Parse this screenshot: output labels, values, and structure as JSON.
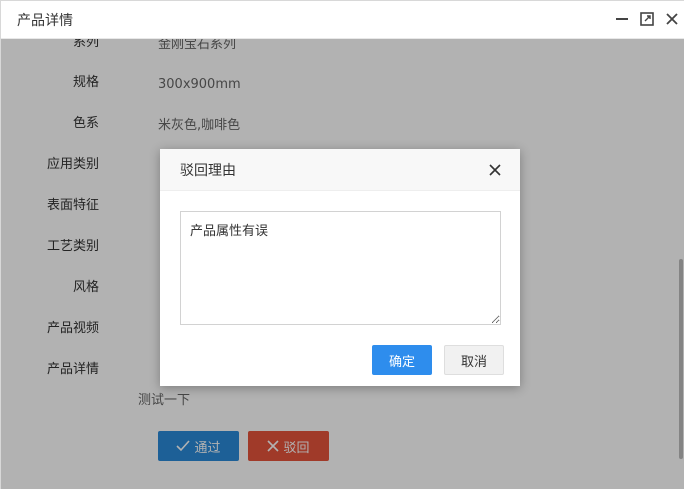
{
  "window": {
    "title": "产品详情",
    "controls": [
      {
        "icon": "minimize-icon"
      },
      {
        "icon": "maximize-icon"
      },
      {
        "icon": "close-icon"
      }
    ]
  },
  "details": {
    "rows": [
      {
        "label": "系列",
        "value": "金刚宝石系列"
      },
      {
        "label": "规格",
        "value": "300x900mm"
      },
      {
        "label": "色系",
        "value": "米灰色,咖啡色"
      },
      {
        "label": "应用类别",
        "value": ""
      },
      {
        "label": "表面特征",
        "value": ""
      },
      {
        "label": "工艺类别",
        "value": ""
      },
      {
        "label": "风格",
        "value": ""
      },
      {
        "label": "产品视频",
        "value": ""
      },
      {
        "label": "产品详情",
        "value": ""
      }
    ],
    "detail_text": "测试一下"
  },
  "actions": {
    "pass_label": "通过",
    "pass_icon": "check-icon",
    "reject_label": "驳回",
    "reject_icon": "x-icon"
  },
  "dialog": {
    "title": "驳回理由",
    "reason_value": "产品属性有误",
    "ok_label": "确定",
    "cancel_label": "取消"
  },
  "colors": {
    "pass": "#2a8ad8",
    "reject": "#e5533c",
    "ok": "#2e8ded",
    "overlay": "rgba(0,0,0,0.30)"
  }
}
